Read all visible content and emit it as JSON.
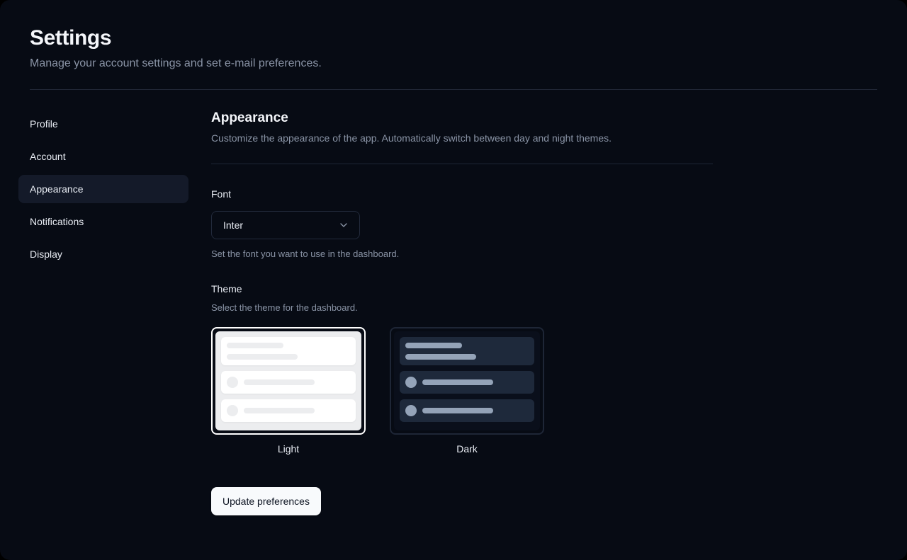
{
  "header": {
    "title": "Settings",
    "subtitle": "Manage your account settings and set e-mail preferences."
  },
  "sidebar": {
    "items": [
      {
        "label": "Profile",
        "active": false
      },
      {
        "label": "Account",
        "active": false
      },
      {
        "label": "Appearance",
        "active": true
      },
      {
        "label": "Notifications",
        "active": false
      },
      {
        "label": "Display",
        "active": false
      }
    ]
  },
  "section": {
    "title": "Appearance",
    "description": "Customize the appearance of the app. Automatically switch between day and night themes."
  },
  "font_field": {
    "label": "Font",
    "selected_value": "Inter",
    "help": "Set the font you want to use in the dashboard."
  },
  "theme_field": {
    "label": "Theme",
    "help": "Select the theme for the dashboard.",
    "options": [
      {
        "label": "Light",
        "selected": true
      },
      {
        "label": "Dark",
        "selected": false
      }
    ]
  },
  "submit": {
    "label": "Update preferences"
  },
  "icons": {
    "font_select": "chevron-down-icon"
  },
  "colors": {
    "page_background": "#070b14",
    "active_item_background": "#141a29",
    "divider": "#1e2536",
    "heading_text": "#f4f6fa",
    "muted_text": "#8a94a6",
    "selected_ring": "#ffffff",
    "light_preview_panel": "#ecedef",
    "light_preview_row": "#ffffff",
    "dark_preview_row": "#1e293b",
    "dark_preview_bar": "#94a3b8",
    "button_background": "#f8fafc",
    "button_text": "#0b1220"
  }
}
